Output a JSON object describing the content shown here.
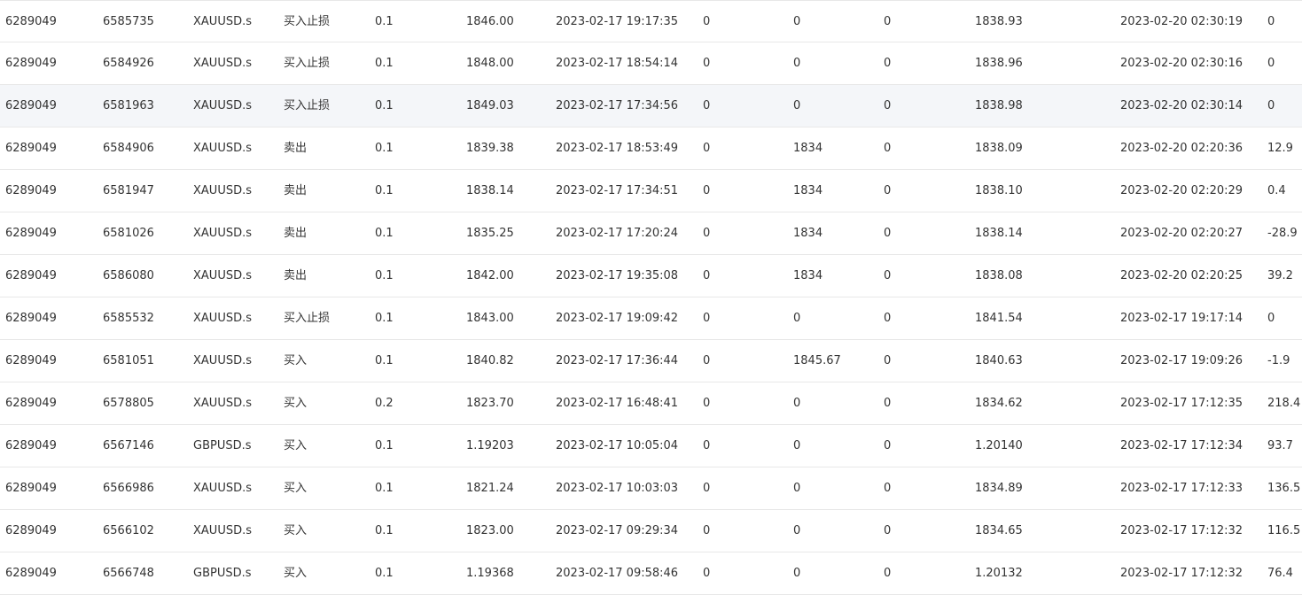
{
  "rows": [
    [
      "6289049",
      "6585735",
      "XAUUSD.s",
      "买入止损",
      "0.1",
      "1846.00",
      "2023-02-17 19:17:35",
      "0",
      "0",
      "0",
      "1838.93",
      "2023-02-20 02:30:19",
      "0"
    ],
    [
      "6289049",
      "6584926",
      "XAUUSD.s",
      "买入止损",
      "0.1",
      "1848.00",
      "2023-02-17 18:54:14",
      "0",
      "0",
      "0",
      "1838.96",
      "2023-02-20 02:30:16",
      "0"
    ],
    [
      "6289049",
      "6581963",
      "XAUUSD.s",
      "买入止损",
      "0.1",
      "1849.03",
      "2023-02-17 17:34:56",
      "0",
      "0",
      "0",
      "1838.98",
      "2023-02-20 02:30:14",
      "0"
    ],
    [
      "6289049",
      "6584906",
      "XAUUSD.s",
      "卖出",
      "0.1",
      "1839.38",
      "2023-02-17 18:53:49",
      "0",
      "1834",
      "0",
      "1838.09",
      "2023-02-20 02:20:36",
      "12.9"
    ],
    [
      "6289049",
      "6581947",
      "XAUUSD.s",
      "卖出",
      "0.1",
      "1838.14",
      "2023-02-17 17:34:51",
      "0",
      "1834",
      "0",
      "1838.10",
      "2023-02-20 02:20:29",
      "0.4"
    ],
    [
      "6289049",
      "6581026",
      "XAUUSD.s",
      "卖出",
      "0.1",
      "1835.25",
      "2023-02-17 17:20:24",
      "0",
      "1834",
      "0",
      "1838.14",
      "2023-02-20 02:20:27",
      "-28.9"
    ],
    [
      "6289049",
      "6586080",
      "XAUUSD.s",
      "卖出",
      "0.1",
      "1842.00",
      "2023-02-17 19:35:08",
      "0",
      "1834",
      "0",
      "1838.08",
      "2023-02-20 02:20:25",
      "39.2"
    ],
    [
      "6289049",
      "6585532",
      "XAUUSD.s",
      "买入止损",
      "0.1",
      "1843.00",
      "2023-02-17 19:09:42",
      "0",
      "0",
      "0",
      "1841.54",
      "2023-02-17 19:17:14",
      "0"
    ],
    [
      "6289049",
      "6581051",
      "XAUUSD.s",
      "买入",
      "0.1",
      "1840.82",
      "2023-02-17 17:36:44",
      "0",
      "1845.67",
      "0",
      "1840.63",
      "2023-02-17 19:09:26",
      "-1.9"
    ],
    [
      "6289049",
      "6578805",
      "XAUUSD.s",
      "买入",
      "0.2",
      "1823.70",
      "2023-02-17 16:48:41",
      "0",
      "0",
      "0",
      "1834.62",
      "2023-02-17 17:12:35",
      "218.4"
    ],
    [
      "6289049",
      "6567146",
      "GBPUSD.s",
      "买入",
      "0.1",
      "1.19203",
      "2023-02-17 10:05:04",
      "0",
      "0",
      "0",
      "1.20140",
      "2023-02-17 17:12:34",
      "93.7"
    ],
    [
      "6289049",
      "6566986",
      "XAUUSD.s",
      "买入",
      "0.1",
      "1821.24",
      "2023-02-17 10:03:03",
      "0",
      "0",
      "0",
      "1834.89",
      "2023-02-17 17:12:33",
      "136.5"
    ],
    [
      "6289049",
      "6566102",
      "XAUUSD.s",
      "买入",
      "0.1",
      "1823.00",
      "2023-02-17 09:29:34",
      "0",
      "0",
      "0",
      "1834.65",
      "2023-02-17 17:12:32",
      "116.5"
    ],
    [
      "6289049",
      "6566748",
      "GBPUSD.s",
      "买入",
      "0.1",
      "1.19368",
      "2023-02-17 09:58:46",
      "0",
      "0",
      "0",
      "1.20132",
      "2023-02-17 17:12:32",
      "76.4"
    ]
  ],
  "highlighted_row": 2,
  "colors": {
    "text": "#333333",
    "row_border": "#e8e8e8",
    "row_hover_bg": "#f4f6f9"
  }
}
